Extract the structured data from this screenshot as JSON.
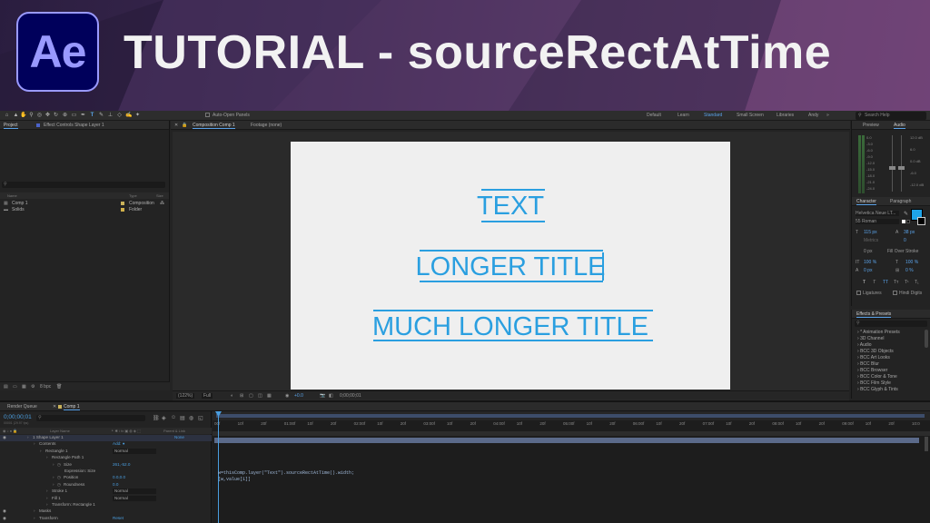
{
  "banner": {
    "logo": "Ae",
    "title": "TUTORIAL - sourceRectAtTime"
  },
  "toolbar": {
    "auto_open_panels": "Auto-Open Panels",
    "workspaces": [
      "Default",
      "Learn",
      "Standard",
      "Small Screen",
      "Libraries",
      "Andy"
    ],
    "active_workspace": "Standard",
    "search_help": "Search Help"
  },
  "project_panel": {
    "tab_project": "Project",
    "tab_effect_controls": "Effect Controls Shape Layer 1",
    "col_name": "Name",
    "col_type": "Type",
    "col_size": "Size",
    "items": [
      {
        "name": "Comp 1",
        "type": "Composition",
        "color": "#c9b25a"
      },
      {
        "name": "Solids",
        "type": "Folder",
        "color": "#d0b04a"
      }
    ],
    "footer_bpc": "8 bpc"
  },
  "composition": {
    "tab_label": "Composition Comp 1",
    "tab_footage": "Footage (none)",
    "breadcrumb": "Comp 1",
    "texts": [
      "TEXT",
      "LONGER TITLE",
      "MUCH LONGER TITLE"
    ],
    "text_color": "#2a9fe0",
    "zoom": "(122%)",
    "resolution": "Full",
    "exposure": "+0.0",
    "timecode": "0;00;00;01"
  },
  "right_panels": {
    "preview_tab": "Preview",
    "audio_tab": "Audio",
    "db_scale": [
      "0.0",
      "-3.0",
      "-6.0",
      "-9.0",
      "-12.0",
      "-15.0",
      "-18.0",
      "-21.0",
      "-24.0"
    ],
    "db_scale_right": [
      "12.0 dB",
      "6.0",
      "0.0 dB",
      "-6.0",
      "-12.0 dB"
    ],
    "character_tab": "Character",
    "paragraph_tab": "Paragraph",
    "font": "Helvetica Neue LT...",
    "font_style": "55 Roman",
    "font_size": "115 px",
    "leading": "38 px",
    "tracking": "0 px",
    "stroke_mode": "Fill Over Stroke",
    "vscale": "100 %",
    "hscale": "100 %",
    "baseline": "0 px",
    "tsume": "0 %",
    "ligatures": "Ligatures",
    "hindi_digits": "Hindi Digits",
    "fill_color": "#1ea3e8",
    "effects_tab": "Effects & Presets",
    "effects": [
      "* Animation Presets",
      "3D Channel",
      "Audio",
      "BCC 3D Objects",
      "BCC Art Looks",
      "BCC Blur",
      "BCC Browser",
      "BCC Color & Tone",
      "BCC Film Style",
      "BCC Glyph & Tints"
    ]
  },
  "timeline": {
    "tab_render_queue": "Render Queue",
    "tab_comp": "Comp 1",
    "timecode": "0;00;00;01",
    "timecode_sub": "00001 (29.97 fps)",
    "col_layer_name": "Layer Name",
    "col_parent": "Parent & Link",
    "parent_value": "None",
    "layers": [
      {
        "indent": 0,
        "name": "1    Shape Layer 1",
        "mode": "",
        "value": "None"
      },
      {
        "indent": 1,
        "name": "Contents",
        "mode": "",
        "value": "Add: ●"
      },
      {
        "indent": 2,
        "name": "Rectangle 1",
        "mode": "Normal",
        "value": ""
      },
      {
        "indent": 3,
        "name": "Rectangle Path 1",
        "mode": "",
        "value": ""
      },
      {
        "indent": 4,
        "name": "Size",
        "mode": "",
        "value": "261,-52.0"
      },
      {
        "indent": 5,
        "name": "Expression: Size",
        "mode": "",
        "value": ""
      },
      {
        "indent": 4,
        "name": "Position",
        "mode": "",
        "value": "0.0,0.0"
      },
      {
        "indent": 4,
        "name": "Roundness",
        "mode": "",
        "value": "0.0"
      },
      {
        "indent": 3,
        "name": "Stroke 1",
        "mode": "Normal",
        "value": ""
      },
      {
        "indent": 3,
        "name": "Fill 1",
        "mode": "Normal",
        "value": ""
      },
      {
        "indent": 3,
        "name": "Transform: Rectangle 1",
        "mode": "",
        "value": ""
      },
      {
        "indent": 1,
        "name": "Masks",
        "mode": "",
        "value": ""
      },
      {
        "indent": 1,
        "name": "Transform",
        "mode": "",
        "value": "Reset"
      }
    ],
    "ruler": [
      "00f",
      "10f",
      "20f",
      "01:00f",
      "10f",
      "20f",
      "02:00f",
      "10f",
      "20f",
      "03:00f",
      "10f",
      "20f",
      "04:00f",
      "10f",
      "20f",
      "05:00f",
      "10f",
      "20f",
      "06:00f",
      "10f",
      "20f",
      "07:00f",
      "10f",
      "20f",
      "08:00f",
      "10f",
      "20f",
      "09:00f",
      "10f",
      "20f",
      "10:0"
    ],
    "expression_lines": [
      "w=thisComp.layer(\"Text\").sourceRectAtTime().width;",
      "[w,value[1]]"
    ]
  }
}
